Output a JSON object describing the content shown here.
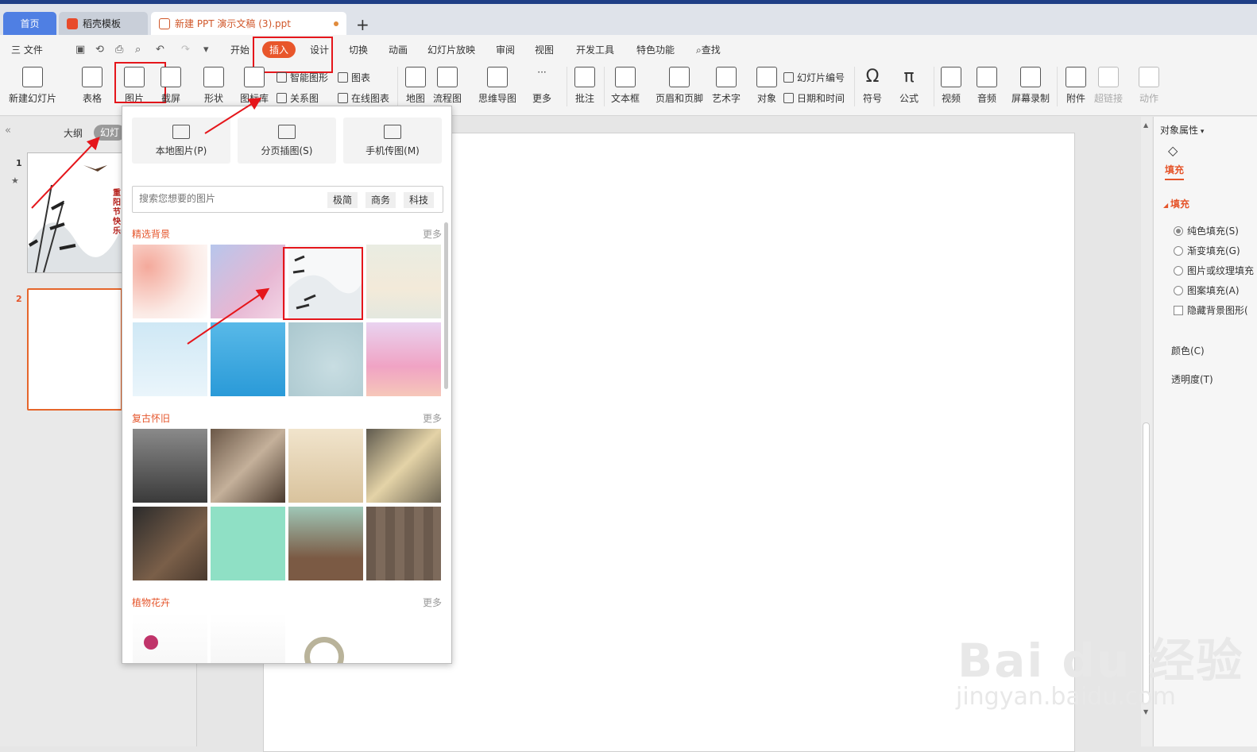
{
  "tabs": {
    "home": "首页",
    "template": "稻壳模板",
    "doc": "新建 PPT 演示文稿 (3).ppt",
    "new_tab": "+"
  },
  "menu": {
    "file": "三 文件",
    "items": [
      "开始",
      "插入",
      "设计",
      "切换",
      "动画",
      "幻灯片放映",
      "审阅",
      "视图",
      "开发工具",
      "特色功能"
    ],
    "find": "查找",
    "active": "插入"
  },
  "ribbon": {
    "new_slide": "新建幻灯片",
    "table": "表格",
    "picture": "图片",
    "screenshot": "截屏",
    "shape": "形状",
    "icon_lib": "图标库",
    "smartart": "智能图形",
    "chart": "图表",
    "relation": "关系图",
    "online_chart": "在线图表",
    "map": "地图",
    "flowchart": "流程图",
    "mindmap": "思维导图",
    "more": "更多",
    "comment": "批注",
    "textbox": "文本框",
    "header_footer": "页眉和页脚",
    "wordart": "艺术字",
    "object": "对象",
    "slide_number": "幻灯片编号",
    "datetime": "日期和时间",
    "symbol": "符号",
    "formula": "公式",
    "video": "视频",
    "audio": "音频",
    "screen_record": "屏幕录制",
    "attachment": "附件",
    "hyperlink": "超链接",
    "action": "动作"
  },
  "leftpane": {
    "outline": "大纲",
    "slides": "幻灯",
    "slide_numbers": [
      "1",
      "2"
    ],
    "slide1_title": "重阳节快乐"
  },
  "popup": {
    "local_picture": "本地图片(P)",
    "page_insert": "分页插图(S)",
    "phone_transfer": "手机传图(M)",
    "search_placeholder": "搜索您想要的图片",
    "tags": [
      "极简",
      "商务",
      "科技"
    ],
    "sections": [
      {
        "title": "精选背景",
        "more": "更多"
      },
      {
        "title": "复古怀旧",
        "more": "更多"
      },
      {
        "title": "植物花卉",
        "more": "更多"
      }
    ]
  },
  "rightpane": {
    "panel_title": "对象属性",
    "tab_fill": "填充",
    "section_fill": "填充",
    "options": [
      "纯色填充(S)",
      "渐变填充(G)",
      "图片或纹理填充",
      "图案填充(A)"
    ],
    "hide_bg": "隐藏背景图形(",
    "color_label": "颜色(C)",
    "transparency_label": "透明度(T)"
  },
  "watermark": {
    "brand": "Bai du 经验",
    "url": "jingyan.baidu.com"
  },
  "colors": {
    "accent": "#e8562b",
    "highlight": "#e5161b",
    "tab_blue": "#4f7fe3"
  }
}
